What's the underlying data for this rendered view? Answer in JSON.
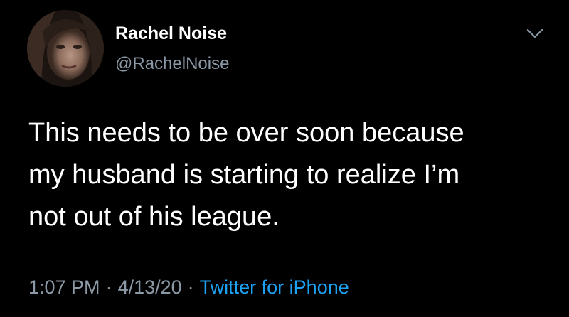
{
  "tweet": {
    "author": {
      "display_name": "Rachel Noise",
      "handle": "@RachelNoise",
      "avatar_icon": "profile-photo"
    },
    "text": "This needs to be over soon because\nmy husband is starting to realize I’m\nnot out of his league.",
    "time": "1:07 PM",
    "date": "4/13/20",
    "separator": "·",
    "source": "Twitter for iPhone",
    "menu_icon": "chevron-down-icon"
  },
  "colors": {
    "background": "#000000",
    "primary_text": "#ffffff",
    "secondary_text": "#8b98a5",
    "link": "#1da1f2"
  }
}
